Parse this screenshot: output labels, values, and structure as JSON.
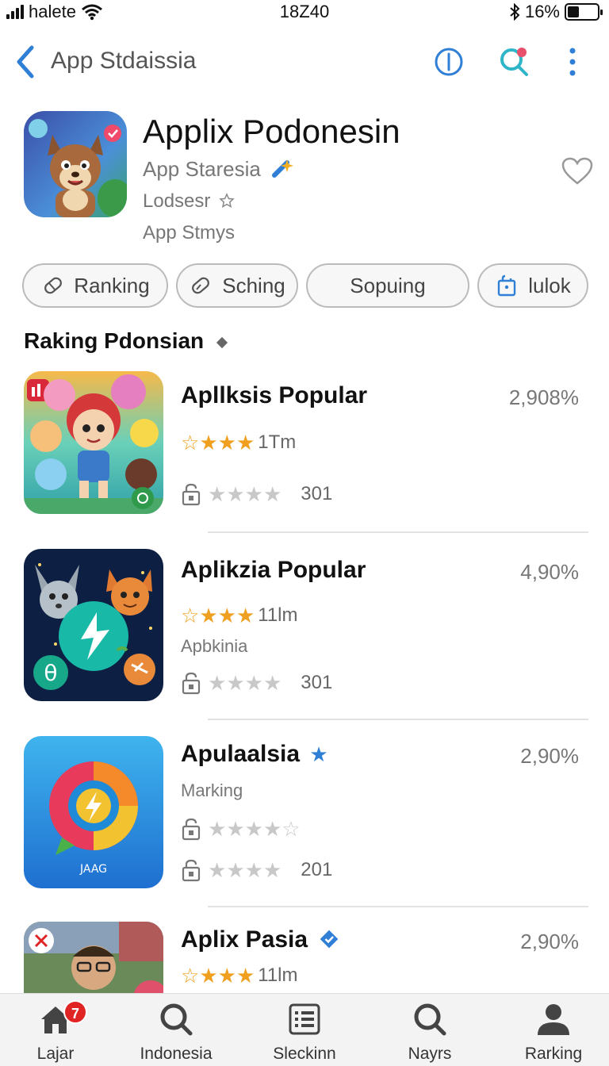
{
  "status_bar": {
    "carrier": "halete",
    "time": "18Z40",
    "battery": "16%"
  },
  "nav": {
    "title": "App Stdaissia"
  },
  "app": {
    "name": "Applix Podonesin",
    "developer": "App Staresia",
    "subtitle1": "Lodsesr",
    "subtitle2": "App Stmys"
  },
  "chips": [
    {
      "label": "Ranking",
      "icon": "tag-icon"
    },
    {
      "label": "Sching",
      "icon": "eraser-icon"
    },
    {
      "label": "Sopuing",
      "icon": ""
    },
    {
      "label": "lulok",
      "icon": "bag-icon"
    }
  ],
  "section": {
    "title": "Raking Pdonsian"
  },
  "items": [
    {
      "title": "Apllksis Popular",
      "percent": "2,908%",
      "rating_text": "1Tm",
      "count": "301",
      "subtext": ""
    },
    {
      "title": "Aplikzia Popular",
      "percent": "4,90%",
      "rating_text": "11lm",
      "subtext": "Apbkinia",
      "count": "301"
    },
    {
      "title": "Apulaalsia",
      "percent": "2,90%",
      "subtext": "Marking",
      "count": "201"
    },
    {
      "title": "Aplix Pasia",
      "percent": "2,90%",
      "rating_text": "11lm"
    }
  ],
  "tabs": [
    {
      "label": "Lajar",
      "badge": "7"
    },
    {
      "label": "Indonesia"
    },
    {
      "label": "Sleckinn"
    },
    {
      "label": "Nayrs"
    },
    {
      "label": "Rarking"
    }
  ],
  "colors": {
    "accent": "#2f7fd6",
    "star": "#f0a020",
    "badge": "#e02424"
  },
  "thumb_label_3": "JAAG"
}
